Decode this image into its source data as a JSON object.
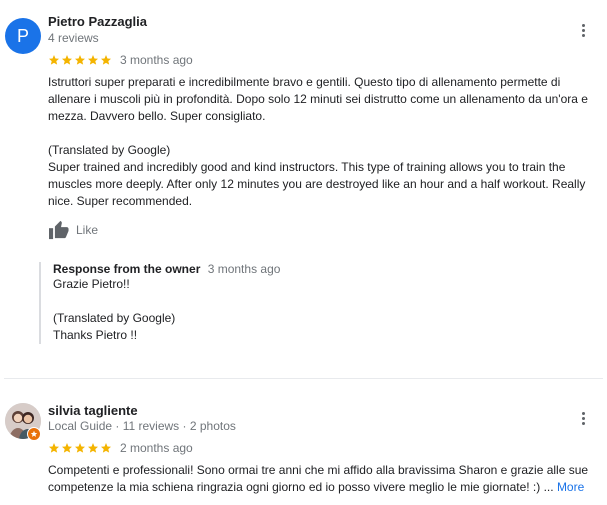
{
  "reviews": [
    {
      "author": "Pietro Pazzaglia",
      "initial": "P",
      "avatar_color": "#1a73e8",
      "subtitle": "4 reviews",
      "rating": 5,
      "date": "3 months ago",
      "original": "Istruttori super preparati e incredibilmente bravo e gentili. Questo tipo di allenamento permette di allenare i muscoli più in profondità. Dopo solo 12 minuti sei distrutto come un allenamento da un'ora e mezza. Davvero bello. Super consigliato.",
      "translated_label": "(Translated by Google)",
      "translation": "Super trained and incredibly good and kind instructors. This type of training allows you to train the muscles more deeply. After only 12 minutes you are destroyed like an hour and a half workout. Really nice. Super recommended.",
      "like_label": "Like",
      "like_icon": "thumbs-up-icon",
      "response": {
        "title": "Response from the owner",
        "date": "3 months ago",
        "original": "Grazie Pietro!!",
        "translated_label": "(Translated by Google)",
        "translation": "Thanks Pietro !!"
      }
    },
    {
      "author": "silvia tagliente",
      "subtitle": "Local Guide · 11 reviews · 2 photos",
      "avatar_icon": "user-photo-icon",
      "badge_color": "#e8710a",
      "rating": 5,
      "date": "2 months ago",
      "text": "Competenti e professionali! Sono ormai tre anni che mi affido alla bravissima Sharon e grazie alle sue competenze la mia schiena ringrazia ogni giorno ed io posso vivere meglio le mie giornate! :) ...",
      "more_label": "More"
    }
  ],
  "colors": {
    "star": "#f4b400",
    "link": "#1a73e8",
    "meta": "#70757a"
  }
}
